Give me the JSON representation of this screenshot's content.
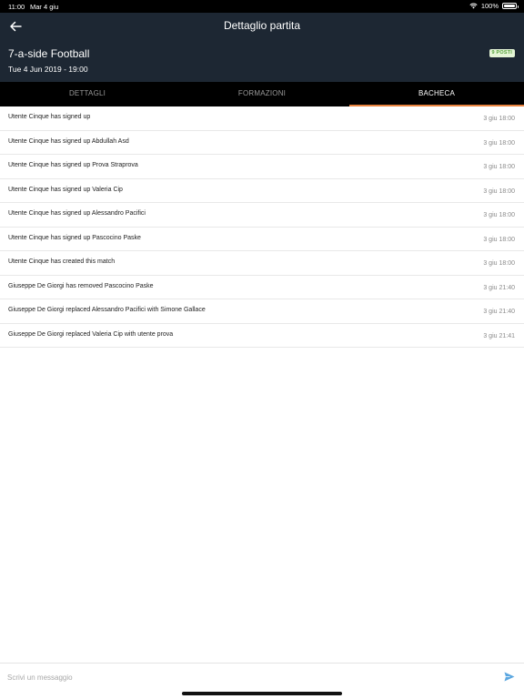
{
  "status_bar": {
    "time": "11:00",
    "date": "Mar 4 giu",
    "battery": "100%"
  },
  "navbar": {
    "title": "Dettaglio partita",
    "back_icon": "arrow-left-icon"
  },
  "match": {
    "title": "7-a-side Football",
    "date": "Tue 4 Jun 2019 - 19:00",
    "badge": "9 POSTI"
  },
  "tabs": [
    {
      "label": "DETTAGLI",
      "active": false
    },
    {
      "label": "FORMAZIONI",
      "active": false
    },
    {
      "label": "BACHECA",
      "active": true
    }
  ],
  "feed": [
    {
      "text": "Utente Cinque has signed up",
      "time": "3 giu 18:00"
    },
    {
      "text": "Utente Cinque has signed up Abdullah Asd",
      "time": "3 giu 18:00"
    },
    {
      "text": "Utente Cinque has signed up Prova Straprova",
      "time": "3 giu 18:00"
    },
    {
      "text": "Utente Cinque has signed up Valeria Cip",
      "time": "3 giu 18:00"
    },
    {
      "text": "Utente Cinque has signed up Alessandro Pacifici",
      "time": "3 giu 18:00"
    },
    {
      "text": "Utente Cinque has signed up Pascocino Paske",
      "time": "3 giu 18:00"
    },
    {
      "text": "Utente Cinque has created this match",
      "time": "3 giu 18:00"
    },
    {
      "text": "Giuseppe De Giorgi has removed Pascocino Paske",
      "time": "3 giu 21:40"
    },
    {
      "text": "Giuseppe De Giorgi replaced Alessandro Pacifici with Simone Gallace",
      "time": "3 giu 21:40"
    },
    {
      "text": "Giuseppe De Giorgi replaced Valeria Cip with utente prova",
      "time": "3 giu 21:41"
    }
  ],
  "composer": {
    "placeholder": "Scrivi un messaggio",
    "value": "",
    "send_icon": "send-icon"
  },
  "colors": {
    "header_bg": "#1d2733",
    "tab_bar_bg": "#000000",
    "tab_indicator": "#e8823e",
    "badge_bg": "#e4f5d6",
    "badge_text": "#58a33e",
    "send_icon": "#5aa6e0"
  }
}
